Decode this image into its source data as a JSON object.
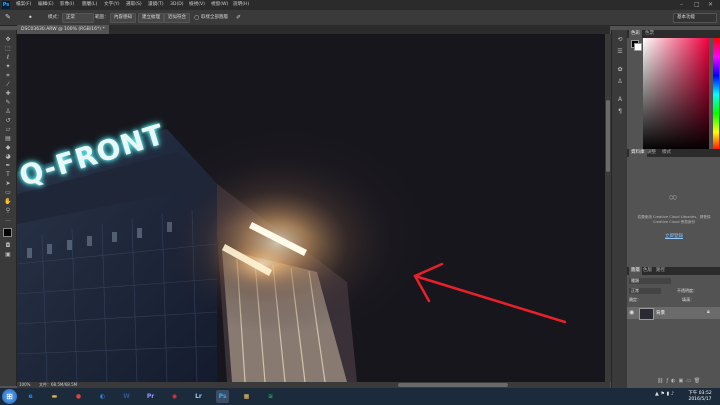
{
  "app": {
    "logo": "Ps"
  },
  "menu": [
    "檔案(F)",
    "編輯(E)",
    "影像(I)",
    "圖層(L)",
    "文字(Y)",
    "選取(S)",
    "濾鏡(T)",
    "3D(D)",
    "檢視(V)",
    "視窗(W)",
    "說明(H)"
  ],
  "window_controls": [
    "–",
    "□",
    "✕"
  ],
  "options_bar": {
    "brush_size": "•",
    "mode_label": "模式：",
    "mode_value": "正常",
    "scope_label": "範圍：",
    "scope_value": "內容感知",
    "btn_create_texture": "建立紋理",
    "btn_proximity_match": "近似符合",
    "sample_all_layers": "取樣全部圖層",
    "workspace": "基本功能"
  },
  "document": {
    "tab_title": "DSC03630.ARW @ 100% (RGB/16*) *"
  },
  "status": {
    "zoom": "100%",
    "doc_info": "文件：68.5M/68.5M"
  },
  "photo": {
    "sign_text": "Q-FRONT"
  },
  "color_panel": {
    "tabs": [
      "色彩",
      "色票"
    ]
  },
  "library_panel": {
    "tabs": [
      "資料庫",
      "調整",
      "樣式"
    ],
    "message": "若要使用 Creative Cloud Libraries，請登錄 Creative Cloud 會員身份",
    "link": "立即登錄"
  },
  "layers_panel": {
    "tabs": [
      "圖層",
      "色版",
      "路徑"
    ],
    "kind_label": "種類",
    "blend_mode": "正常",
    "opacity_label": "不透明度：",
    "fill_label": "填滿：",
    "lock_label": "鎖定：",
    "layer_name": "背景"
  },
  "taskbar": {
    "time": "下午 03:52",
    "date": "2016/5/17",
    "apps": [
      {
        "name": "ie",
        "label": "e",
        "color": "#1e90ff"
      },
      {
        "name": "explorer",
        "label": "▬",
        "color": "#e8b84a"
      },
      {
        "name": "chrome",
        "label": "●",
        "color": "#db4437"
      },
      {
        "name": "edge",
        "label": "◐",
        "color": "#2f7fd6"
      },
      {
        "name": "word",
        "label": "W",
        "color": "#2b579a"
      },
      {
        "name": "premiere",
        "label": "Pr",
        "color": "#9999ff"
      },
      {
        "name": "app-red",
        "label": "◉",
        "color": "#e33"
      },
      {
        "name": "lightroom",
        "label": "Lr",
        "color": "#9ecbf0"
      },
      {
        "name": "photoshop",
        "label": "Ps",
        "color": "#31a8ff"
      },
      {
        "name": "photo-viewer",
        "label": "▦",
        "color": "#e8c070"
      },
      {
        "name": "spotify",
        "label": "≋",
        "color": "#1db954"
      }
    ]
  }
}
